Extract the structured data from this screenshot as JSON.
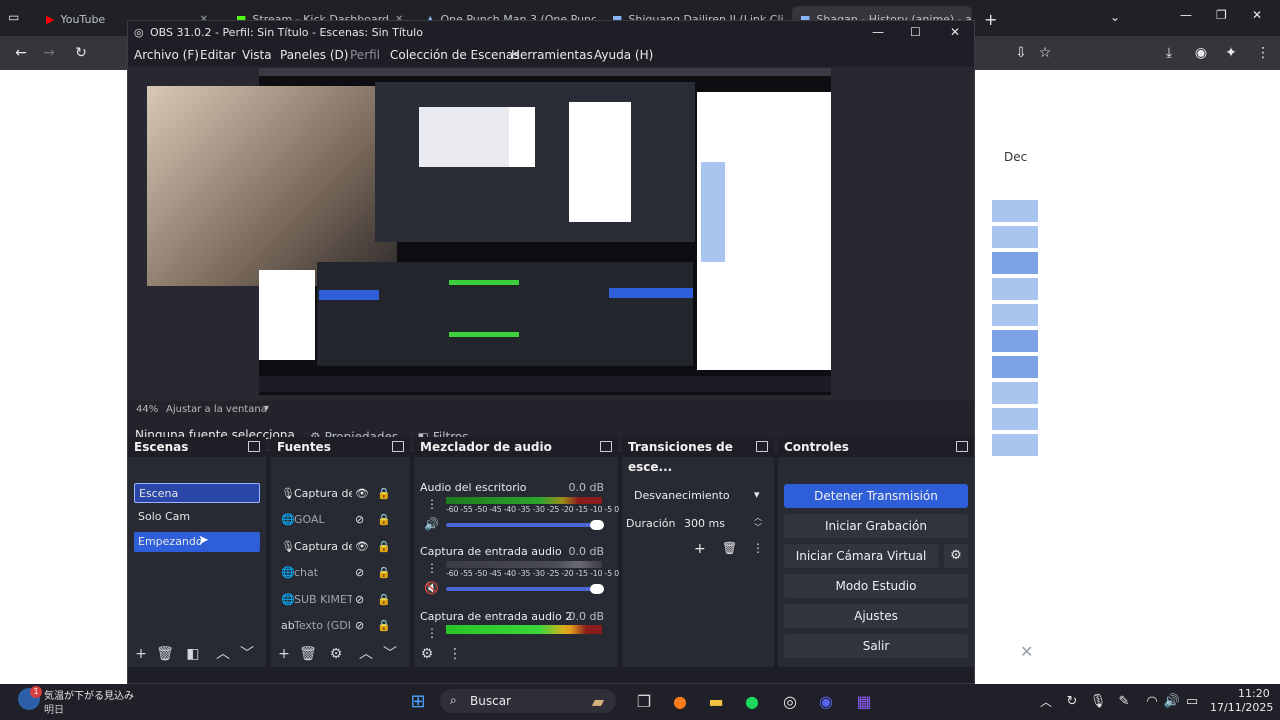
{
  "browser": {
    "tabs": [
      {
        "label": "YouTube"
      },
      {
        "label": "Stream - Kick Dashboard"
      },
      {
        "label": "One Punch Man 3 (One Punch"
      },
      {
        "label": "Shiguang Dailiren II (Link Click"
      },
      {
        "label": "Shagan - History (anime) - anic"
      }
    ],
    "page_text": "Dec"
  },
  "obs": {
    "title": "OBS 31.0.2 - Perfil: Sin Título - Escenas: Sin Título",
    "menu": [
      "Archivo (F)",
      "Editar",
      "Vista",
      "Paneles (D)",
      "Perfil",
      "Colección de Escenas",
      "Herramientas",
      "Ayuda (H)"
    ],
    "zoom": "44%",
    "zoom_mode": "Ajustar a la ventana",
    "no_source": "Ninguna fuente selecciona",
    "properties_label": "Propiedades",
    "filters_label": "Filtros",
    "scenes": {
      "title": "Escenas",
      "items": [
        "Escena",
        "Solo Cam",
        "Empezando"
      ]
    },
    "sources": {
      "title": "Fuentes",
      "items": [
        {
          "name": "Captura de",
          "icon": "mic-icon"
        },
        {
          "name": "GOAL",
          "icon": "globe-icon"
        },
        {
          "name": "Captura de",
          "icon": "mic-icon"
        },
        {
          "name": "chat",
          "icon": "globe-icon"
        },
        {
          "name": "SUB KIMET",
          "icon": "globe-icon"
        },
        {
          "name": "Texto (GDI+",
          "icon": "text-icon"
        }
      ]
    },
    "mixer": {
      "title": "Mezclador de audio",
      "scale": "-60 -55 -50 -45 -40 -35 -30 -25 -20 -15 -10 -5  0",
      "channels": [
        {
          "name": "Audio del escritorio",
          "db": "0.0 dB"
        },
        {
          "name": "Captura de entrada audio",
          "db": "0.0 dB"
        },
        {
          "name": "Captura de entrada audio 2",
          "db": "0.0 dB"
        }
      ]
    },
    "transitions": {
      "title": "Transiciones de esce...",
      "selected": "Desvanecimiento",
      "duration_label": "Duración",
      "duration_value": "300 ms"
    },
    "controls": {
      "title": "Controles",
      "buttons": [
        "Detener Transmisión",
        "Iniciar Grabación",
        "Iniciar Cámara Virtual",
        "Modo Estudio",
        "Ajustes",
        "Salir"
      ]
    }
  },
  "taskbar": {
    "weather_title": "気温が下がる見込み",
    "weather_sub": "明日",
    "weather_badge": "1",
    "search_label": "Buscar",
    "time": "11:20",
    "date": "17/11/2025"
  },
  "colors": {
    "accent": "#2e5ed8",
    "obs_bg": "#1e1f26",
    "dock_bg": "#272a33"
  }
}
